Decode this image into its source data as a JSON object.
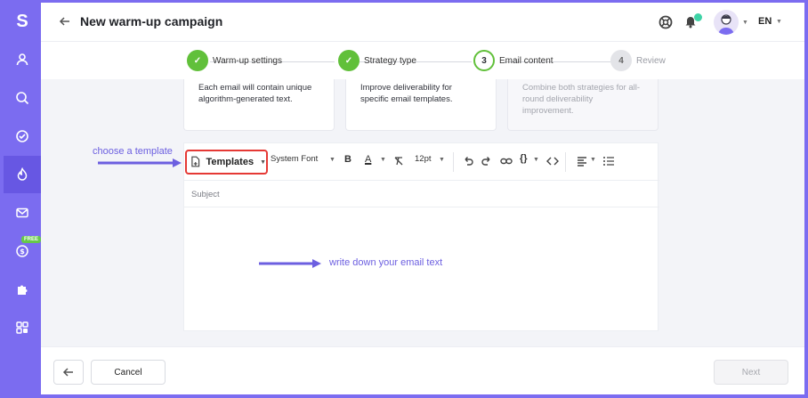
{
  "header": {
    "title": "New warm-up campaign",
    "language": "EN"
  },
  "sidebar": {
    "logo": "S",
    "items": [
      {
        "icon": "user-icon"
      },
      {
        "icon": "search-icon"
      },
      {
        "icon": "check-circle-icon"
      },
      {
        "icon": "flame-icon",
        "active": true
      },
      {
        "icon": "mail-icon"
      },
      {
        "icon": "dollar-icon",
        "badge": "FREE"
      },
      {
        "icon": "puzzle-icon"
      },
      {
        "icon": "grid-icon"
      }
    ]
  },
  "stepper": {
    "steps": [
      {
        "number": "",
        "label": "Warm-up settings",
        "state": "done"
      },
      {
        "number": "",
        "label": "Strategy type",
        "state": "done"
      },
      {
        "number": "3",
        "label": "Email content",
        "state": "current"
      },
      {
        "number": "4",
        "label": "Review",
        "state": "todo"
      }
    ]
  },
  "strategy_cards": [
    {
      "text": "Each email will contain unique algorithm-generated text."
    },
    {
      "text": "Improve deliverability for specific email templates."
    },
    {
      "text": "Combine both strategies for all-round deliverability improvement."
    }
  ],
  "editor": {
    "templates_label": "Templates",
    "font": "System Font",
    "font_size": "12pt",
    "subject_placeholder": "Subject"
  },
  "annotations": {
    "choose_template": "choose a template",
    "write_email": "write down your email text"
  },
  "footer": {
    "cancel_label": "Cancel",
    "next_label": "Next"
  },
  "colors": {
    "brand": "#7b6cf0",
    "success": "#61c03a",
    "highlight": "#e53935"
  }
}
